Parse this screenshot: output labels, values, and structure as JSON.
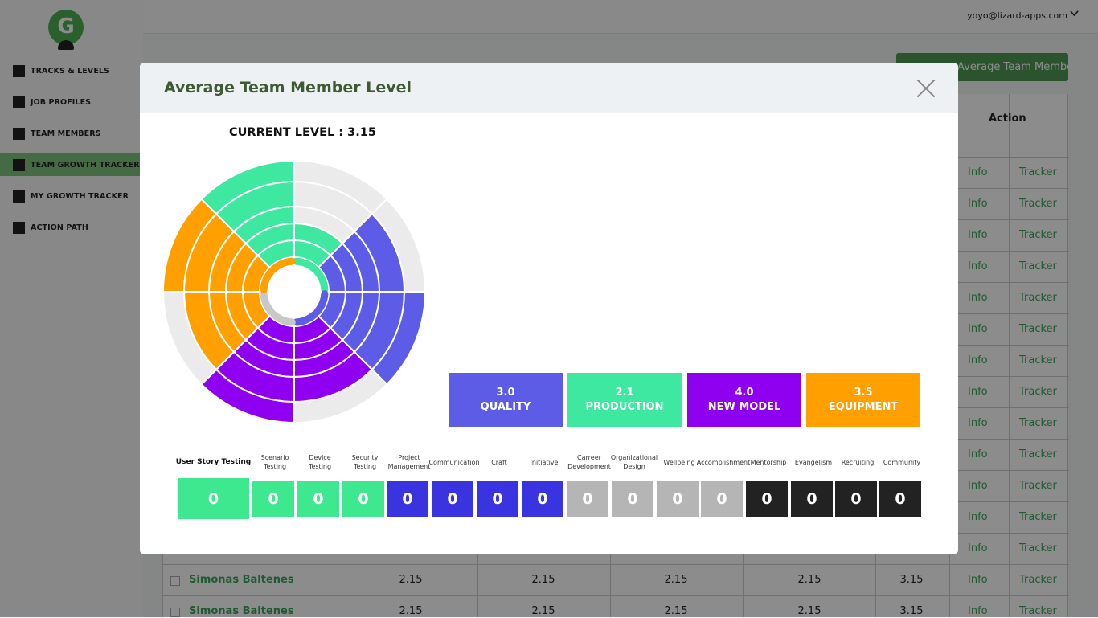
{
  "sidebar": {
    "logo_letter": "G",
    "items": [
      {
        "label": "TRACKS & LEVELS",
        "active": false
      },
      {
        "label": "JOB PROFILES",
        "active": false
      },
      {
        "label": "TEAM MEMBERS",
        "active": false
      },
      {
        "label": "TEAM GROWTH TRACKER",
        "active": true
      },
      {
        "label": "MY GROWTH TRACKER",
        "active": false
      },
      {
        "label": "ACTION PATH",
        "active": false
      }
    ]
  },
  "header": {
    "user_email": "yoyo@lizard-apps.com",
    "menu_icon": "chevron-down-icon"
  },
  "background": {
    "team_button_label": "Average Team Member Level",
    "action_header": "Action",
    "info_label": "Info",
    "tracker_label": "Tracker",
    "rows": [
      {
        "name": "Simonas Baltenes",
        "values": [
          "2.15",
          "2.15",
          "2.15",
          "2.15",
          "3.15"
        ]
      },
      {
        "name": "Simonas Baltenes",
        "values": [
          "2.15",
          "2.15",
          "2.15",
          "2.15",
          "3.15"
        ]
      }
    ]
  },
  "modal": {
    "title": "Average Team Member Level",
    "close_icon": "close-icon",
    "current_level_label": "CURRENT LEVEL : 3.15",
    "cards": [
      {
        "value": "3.0",
        "label": "QUALITY",
        "color": "#5c5ce6"
      },
      {
        "value": "2.1",
        "label": "PRODUCTION",
        "color": "#3ee8a0"
      },
      {
        "value": "4.0",
        "label": "NEW MODEL",
        "color": "#9000f0"
      },
      {
        "value": "3.5",
        "label": "EQUIPMENT",
        "color": "#ffa000"
      }
    ],
    "skills": [
      {
        "label": "User Story Testing",
        "value": "0",
        "color": "#3ee88e",
        "selected": true
      },
      {
        "label": "Scenario Testing",
        "value": "0",
        "color": "#3ee88e"
      },
      {
        "label": "Device Testing",
        "value": "0",
        "color": "#3ee88e"
      },
      {
        "label": "Security Testing",
        "value": "0",
        "color": "#3ee88e"
      },
      {
        "label": "Project Management",
        "value": "0",
        "color": "#3a34e0"
      },
      {
        "label": "Communication",
        "value": "0",
        "color": "#3a34e0"
      },
      {
        "label": "Craft",
        "value": "0",
        "color": "#3a34e0"
      },
      {
        "label": "Initiative",
        "value": "0",
        "color": "#3a34e0"
      },
      {
        "label": "Carreer Development",
        "value": "0",
        "color": "#b5b5b5"
      },
      {
        "label": "Organizational Design",
        "value": "0",
        "color": "#b5b5b5"
      },
      {
        "label": "Wellbeing",
        "value": "0",
        "color": "#b5b5b5"
      },
      {
        "label": "Accomplishment",
        "value": "0",
        "color": "#b5b5b5"
      },
      {
        "label": "Mentorship",
        "value": "0",
        "color": "#222222"
      },
      {
        "label": "Evangelism",
        "value": "0",
        "color": "#222222"
      },
      {
        "label": "Recruiting",
        "value": "0",
        "color": "#222222"
      },
      {
        "label": "Community",
        "value": "0",
        "color": "#222222"
      }
    ],
    "wheel": {
      "empty_color": "#ebebeb",
      "rings": 5,
      "sectors": [
        {
          "start": 0,
          "level": 2,
          "color": "#3ee8a0"
        },
        {
          "start": 45,
          "level": 4,
          "color": "#5c5ce6"
        },
        {
          "start": 90,
          "level": 5,
          "color": "#5c5ce6"
        },
        {
          "start": 135,
          "level": 4,
          "color": "#9000f0"
        },
        {
          "start": 180,
          "level": 5,
          "color": "#9000f0"
        },
        {
          "start": 225,
          "level": 4,
          "color": "#ffa000"
        },
        {
          "start": 270,
          "level": 5,
          "color": "#ffa000"
        },
        {
          "start": 315,
          "level": 5,
          "color": "#3ee8a0"
        }
      ],
      "inner_dashes": [
        {
          "color": "#3ee8a0"
        },
        {
          "color": "#3ee8a0"
        },
        {
          "color": "#5c5ce6"
        },
        {
          "color": "#5c5ce6"
        },
        {
          "color": "#c8c8c8"
        },
        {
          "color": "#c8c8c8"
        },
        {
          "color": "#ffa000"
        },
        {
          "color": "#ffa000"
        }
      ]
    }
  }
}
